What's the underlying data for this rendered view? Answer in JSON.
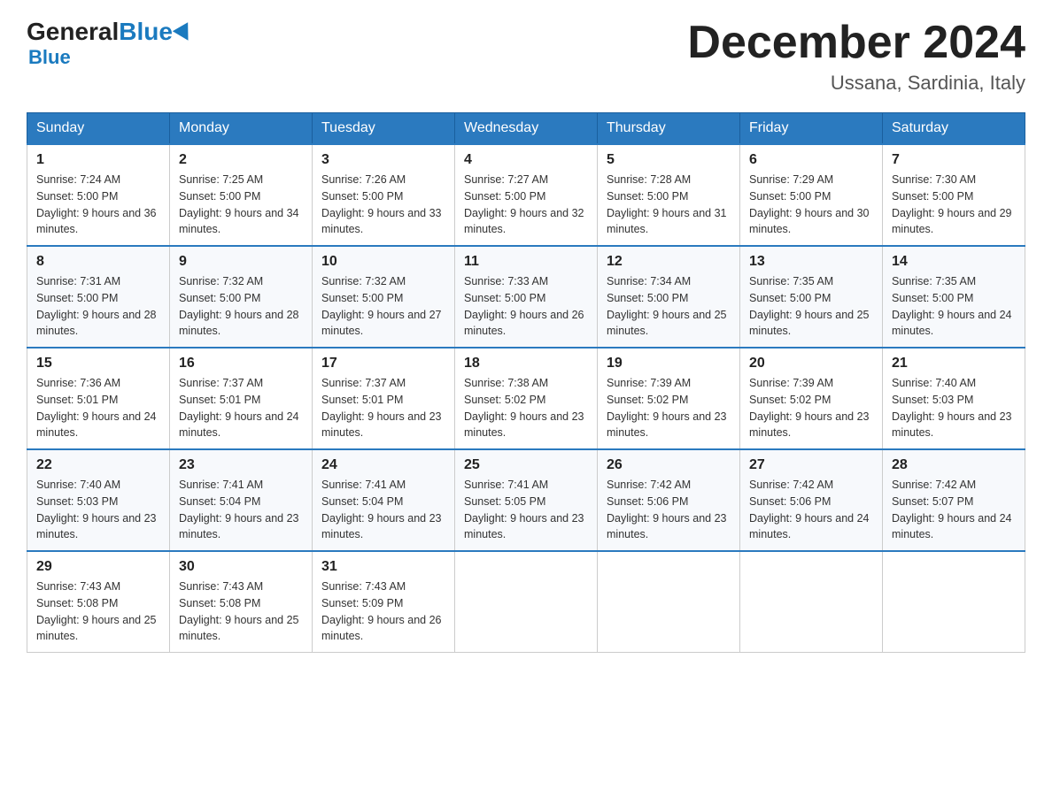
{
  "header": {
    "logo_general": "General",
    "logo_blue": "Blue",
    "title": "December 2024",
    "location": "Ussana, Sardinia, Italy"
  },
  "days_of_week": [
    "Sunday",
    "Monday",
    "Tuesday",
    "Wednesday",
    "Thursday",
    "Friday",
    "Saturday"
  ],
  "weeks": [
    [
      {
        "day": "1",
        "sunrise": "7:24 AM",
        "sunset": "5:00 PM",
        "daylight": "9 hours and 36 minutes."
      },
      {
        "day": "2",
        "sunrise": "7:25 AM",
        "sunset": "5:00 PM",
        "daylight": "9 hours and 34 minutes."
      },
      {
        "day": "3",
        "sunrise": "7:26 AM",
        "sunset": "5:00 PM",
        "daylight": "9 hours and 33 minutes."
      },
      {
        "day": "4",
        "sunrise": "7:27 AM",
        "sunset": "5:00 PM",
        "daylight": "9 hours and 32 minutes."
      },
      {
        "day": "5",
        "sunrise": "7:28 AM",
        "sunset": "5:00 PM",
        "daylight": "9 hours and 31 minutes."
      },
      {
        "day": "6",
        "sunrise": "7:29 AM",
        "sunset": "5:00 PM",
        "daylight": "9 hours and 30 minutes."
      },
      {
        "day": "7",
        "sunrise": "7:30 AM",
        "sunset": "5:00 PM",
        "daylight": "9 hours and 29 minutes."
      }
    ],
    [
      {
        "day": "8",
        "sunrise": "7:31 AM",
        "sunset": "5:00 PM",
        "daylight": "9 hours and 28 minutes."
      },
      {
        "day": "9",
        "sunrise": "7:32 AM",
        "sunset": "5:00 PM",
        "daylight": "9 hours and 28 minutes."
      },
      {
        "day": "10",
        "sunrise": "7:32 AM",
        "sunset": "5:00 PM",
        "daylight": "9 hours and 27 minutes."
      },
      {
        "day": "11",
        "sunrise": "7:33 AM",
        "sunset": "5:00 PM",
        "daylight": "9 hours and 26 minutes."
      },
      {
        "day": "12",
        "sunrise": "7:34 AM",
        "sunset": "5:00 PM",
        "daylight": "9 hours and 25 minutes."
      },
      {
        "day": "13",
        "sunrise": "7:35 AM",
        "sunset": "5:00 PM",
        "daylight": "9 hours and 25 minutes."
      },
      {
        "day": "14",
        "sunrise": "7:35 AM",
        "sunset": "5:00 PM",
        "daylight": "9 hours and 24 minutes."
      }
    ],
    [
      {
        "day": "15",
        "sunrise": "7:36 AM",
        "sunset": "5:01 PM",
        "daylight": "9 hours and 24 minutes."
      },
      {
        "day": "16",
        "sunrise": "7:37 AM",
        "sunset": "5:01 PM",
        "daylight": "9 hours and 24 minutes."
      },
      {
        "day": "17",
        "sunrise": "7:37 AM",
        "sunset": "5:01 PM",
        "daylight": "9 hours and 23 minutes."
      },
      {
        "day": "18",
        "sunrise": "7:38 AM",
        "sunset": "5:02 PM",
        "daylight": "9 hours and 23 minutes."
      },
      {
        "day": "19",
        "sunrise": "7:39 AM",
        "sunset": "5:02 PM",
        "daylight": "9 hours and 23 minutes."
      },
      {
        "day": "20",
        "sunrise": "7:39 AM",
        "sunset": "5:02 PM",
        "daylight": "9 hours and 23 minutes."
      },
      {
        "day": "21",
        "sunrise": "7:40 AM",
        "sunset": "5:03 PM",
        "daylight": "9 hours and 23 minutes."
      }
    ],
    [
      {
        "day": "22",
        "sunrise": "7:40 AM",
        "sunset": "5:03 PM",
        "daylight": "9 hours and 23 minutes."
      },
      {
        "day": "23",
        "sunrise": "7:41 AM",
        "sunset": "5:04 PM",
        "daylight": "9 hours and 23 minutes."
      },
      {
        "day": "24",
        "sunrise": "7:41 AM",
        "sunset": "5:04 PM",
        "daylight": "9 hours and 23 minutes."
      },
      {
        "day": "25",
        "sunrise": "7:41 AM",
        "sunset": "5:05 PM",
        "daylight": "9 hours and 23 minutes."
      },
      {
        "day": "26",
        "sunrise": "7:42 AM",
        "sunset": "5:06 PM",
        "daylight": "9 hours and 23 minutes."
      },
      {
        "day": "27",
        "sunrise": "7:42 AM",
        "sunset": "5:06 PM",
        "daylight": "9 hours and 24 minutes."
      },
      {
        "day": "28",
        "sunrise": "7:42 AM",
        "sunset": "5:07 PM",
        "daylight": "9 hours and 24 minutes."
      }
    ],
    [
      {
        "day": "29",
        "sunrise": "7:43 AM",
        "sunset": "5:08 PM",
        "daylight": "9 hours and 25 minutes."
      },
      {
        "day": "30",
        "sunrise": "7:43 AM",
        "sunset": "5:08 PM",
        "daylight": "9 hours and 25 minutes."
      },
      {
        "day": "31",
        "sunrise": "7:43 AM",
        "sunset": "5:09 PM",
        "daylight": "9 hours and 26 minutes."
      },
      null,
      null,
      null,
      null
    ]
  ],
  "labels": {
    "sunrise_prefix": "Sunrise: ",
    "sunset_prefix": "Sunset: ",
    "daylight_prefix": "Daylight: "
  }
}
